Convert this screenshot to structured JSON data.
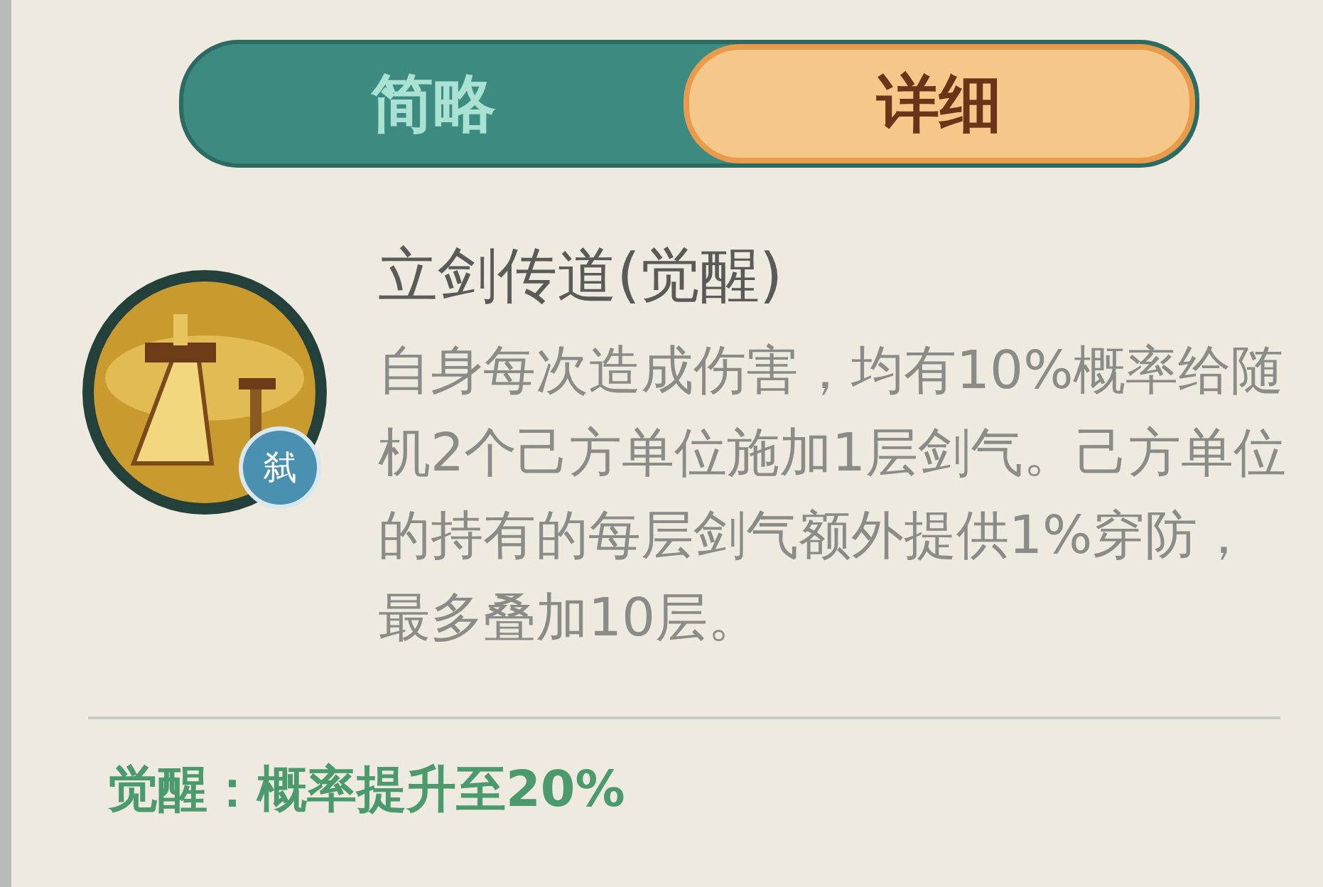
{
  "tabs": [
    {
      "label": "简略",
      "selected": false
    },
    {
      "label": "详细",
      "selected": true
    }
  ],
  "skill": {
    "name": "立剑传道(觉醒)",
    "badge": "弑",
    "description": "自身每次造成伤害，均有10%概率给随机2个己方单位施加1层剑气。己方单位的持有的每层剑气额外提供1%穿防，最多叠加10层。"
  },
  "awakening": "觉醒：概率提升至20%"
}
